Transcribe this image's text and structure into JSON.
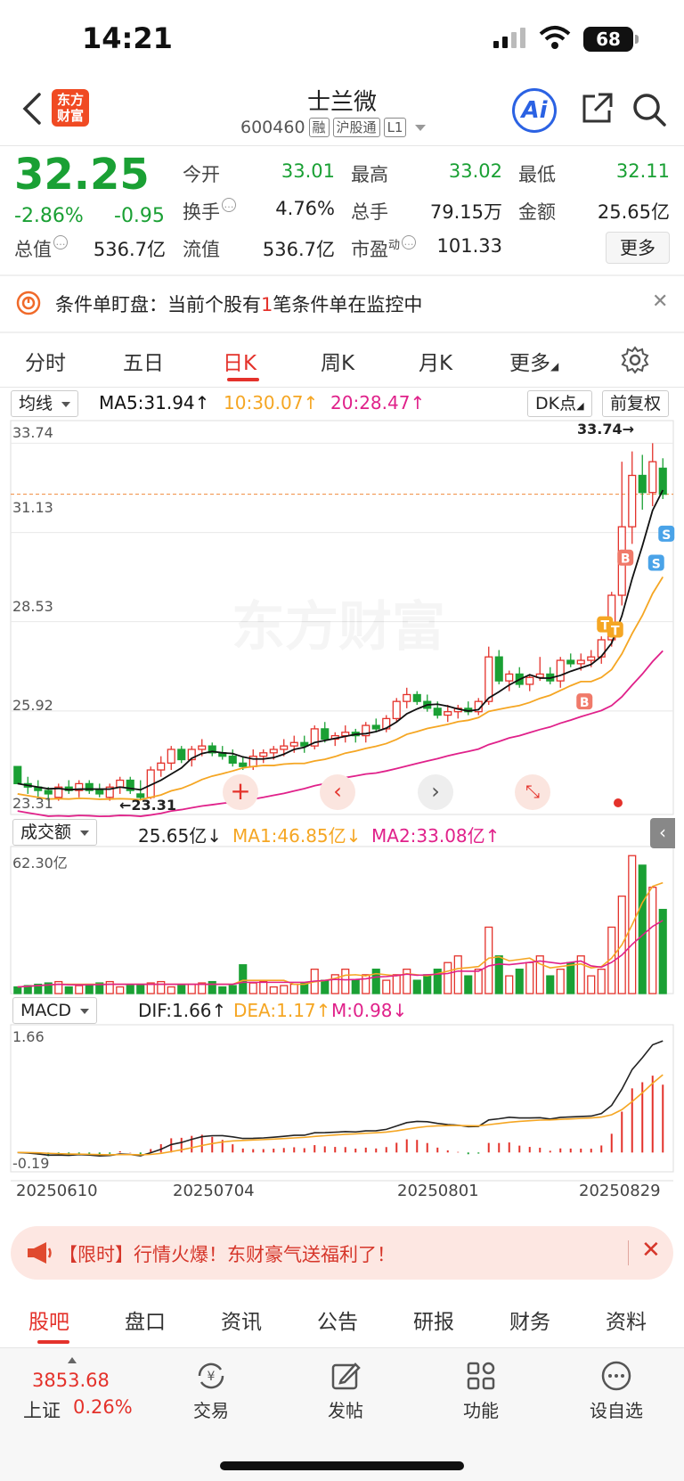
{
  "status": {
    "time": "14:21",
    "battery": "68"
  },
  "nav": {
    "logo": "东方财富",
    "title": "士兰微",
    "code": "600460",
    "tags": [
      "融",
      "沪股通",
      "L1"
    ],
    "ai_label": "Ai"
  },
  "quote": {
    "price": "32.25",
    "change_pct": "-2.86%",
    "change": "-0.95",
    "fields": [
      {
        "label": "今开",
        "value": "33.01"
      },
      {
        "label": "最高",
        "value": "33.02"
      },
      {
        "label": "最低",
        "value": "32.11"
      },
      {
        "label": "换手",
        "value": "4.76%"
      },
      {
        "label": "总手",
        "value": "79.15万"
      },
      {
        "label": "金额",
        "value": "25.65亿"
      },
      {
        "label": "总值",
        "value": "536.7亿"
      },
      {
        "label": "流值",
        "value": "536.7亿"
      },
      {
        "label": "市盈",
        "label_sup": "动",
        "value": "101.33"
      }
    ],
    "more_label": "更多"
  },
  "alert": {
    "prefix": "条件单盯盘：当前个股有",
    "count": "1",
    "suffix": "笔条件单在监控中"
  },
  "ktabs": [
    "分时",
    "五日",
    "日K",
    "周K",
    "月K",
    "更多"
  ],
  "ma_bar": {
    "select": "均线",
    "ma5": "MA5:31.94↑",
    "ma10": "10:30.07↑",
    "ma20": "20:28.47↑",
    "dk": "DK点",
    "fq": "前复权"
  },
  "colors": {
    "up": "#e4322b",
    "down": "#1aa034",
    "ma5": "#111111",
    "ma10": "#f5a623",
    "ma20": "#e0218a"
  },
  "chart_data": [
    {
      "type": "candlestick",
      "name_panel": "daily-k",
      "y_ticks": [
        "33.74",
        "31.13",
        "28.53",
        "25.92",
        "23.31"
      ],
      "ylim": [
        22.9,
        34.4
      ],
      "high_label": "33.74→",
      "low_label": "←23.31",
      "watermark": "东方财富",
      "signal_labels": [
        "B",
        "B",
        "T",
        "T",
        "S",
        "S"
      ],
      "x_dates": [
        "20250610",
        "20250704",
        "20250801",
        "20250829"
      ],
      "ohlc": [
        [
          24.3,
          24.3,
          23.8,
          23.8
        ],
        [
          23.8,
          24.0,
          23.5,
          23.7
        ],
        [
          23.7,
          23.9,
          23.4,
          23.6
        ],
        [
          23.6,
          23.7,
          23.3,
          23.5
        ],
        [
          23.4,
          23.8,
          23.3,
          23.7
        ],
        [
          23.7,
          23.9,
          23.5,
          23.6
        ],
        [
          23.6,
          23.9,
          23.4,
          23.8
        ],
        [
          23.8,
          23.9,
          23.5,
          23.6
        ],
        [
          23.6,
          23.8,
          23.4,
          23.5
        ],
        [
          23.4,
          23.8,
          23.3,
          23.7
        ],
        [
          23.7,
          24.0,
          23.5,
          23.9
        ],
        [
          23.9,
          24.0,
          23.5,
          23.6
        ],
        [
          23.5,
          23.9,
          23.31,
          23.4
        ],
        [
          23.4,
          24.3,
          23.35,
          24.2
        ],
        [
          24.2,
          24.6,
          24.0,
          24.4
        ],
        [
          24.4,
          24.9,
          24.2,
          24.8
        ],
        [
          24.8,
          24.9,
          24.4,
          24.5
        ],
        [
          24.5,
          24.9,
          24.3,
          24.8
        ],
        [
          24.8,
          25.1,
          24.6,
          24.9
        ],
        [
          24.9,
          25.0,
          24.6,
          24.7
        ],
        [
          24.7,
          24.9,
          24.5,
          24.6
        ],
        [
          24.6,
          24.8,
          24.3,
          24.4
        ],
        [
          24.4,
          24.6,
          24.2,
          24.3
        ],
        [
          24.3,
          24.8,
          24.2,
          24.6
        ],
        [
          24.6,
          24.8,
          24.4,
          24.7
        ],
        [
          24.7,
          24.9,
          24.5,
          24.8
        ],
        [
          24.8,
          25.1,
          24.6,
          24.9
        ],
        [
          24.9,
          25.2,
          24.7,
          25.0
        ],
        [
          25.0,
          25.2,
          24.7,
          24.9
        ],
        [
          24.9,
          25.5,
          24.8,
          25.4
        ],
        [
          25.4,
          25.6,
          25.0,
          25.1
        ],
        [
          25.1,
          25.3,
          24.9,
          25.2
        ],
        [
          25.2,
          25.5,
          25.0,
          25.3
        ],
        [
          25.3,
          25.4,
          25.0,
          25.2
        ],
        [
          25.2,
          25.6,
          25.0,
          25.5
        ],
        [
          25.5,
          25.7,
          25.3,
          25.4
        ],
        [
          25.4,
          25.8,
          25.3,
          25.7
        ],
        [
          25.7,
          26.3,
          25.6,
          26.2
        ],
        [
          26.2,
          26.6,
          26.0,
          26.4
        ],
        [
          26.4,
          26.5,
          26.1,
          26.2
        ],
        [
          26.2,
          26.4,
          25.9,
          26.0
        ],
        [
          26.0,
          26.2,
          25.7,
          25.8
        ],
        [
          25.8,
          26.1,
          25.6,
          25.9
        ],
        [
          25.9,
          26.1,
          25.7,
          26.0
        ],
        [
          26.0,
          26.2,
          25.8,
          25.9
        ],
        [
          25.9,
          26.3,
          25.8,
          26.2
        ],
        [
          26.2,
          27.8,
          26.1,
          27.5
        ],
        [
          27.5,
          27.7,
          26.7,
          26.8
        ],
        [
          26.8,
          27.1,
          26.5,
          27.0
        ],
        [
          27.0,
          27.2,
          26.6,
          26.7
        ],
        [
          26.7,
          27.0,
          26.5,
          26.9
        ],
        [
          26.9,
          27.5,
          26.8,
          27.0
        ],
        [
          27.0,
          27.2,
          26.7,
          26.8
        ],
        [
          26.8,
          27.5,
          26.6,
          27.4
        ],
        [
          27.4,
          27.6,
          27.2,
          27.3
        ],
        [
          27.3,
          27.6,
          27.1,
          27.4
        ],
        [
          27.4,
          27.7,
          27.2,
          27.5
        ],
        [
          27.5,
          28.1,
          27.3,
          28.0
        ],
        [
          28.0,
          29.4,
          27.8,
          29.3
        ],
        [
          29.3,
          33.2,
          29.0,
          31.3
        ],
        [
          31.3,
          33.5,
          30.8,
          32.8
        ],
        [
          32.8,
          33.4,
          31.8,
          32.3
        ],
        [
          32.3,
          33.74,
          31.9,
          33.2
        ],
        [
          33.01,
          33.3,
          32.11,
          32.25
        ]
      ],
      "series": [
        {
          "name": "MA5"
        },
        {
          "name": "10"
        },
        {
          "name": "20"
        }
      ]
    },
    {
      "type": "bar",
      "name_panel": "volume",
      "select": "成交额",
      "value_label": "25.65亿↓",
      "ma1_label": "MA1:46.85亿↓",
      "ma2_label": "MA2:33.08亿↑",
      "y_tick": "62.30亿",
      "ylim": [
        0,
        64
      ]
    },
    {
      "type": "line",
      "name_panel": "macd",
      "select": "MACD",
      "dif_label": "DIF:1.66↑",
      "dea_label": "DEA:1.17↑",
      "m_label": "M:0.98↓",
      "y_ticks": [
        "1.66",
        "-0.19"
      ]
    }
  ],
  "banner": {
    "text": "【限时】行情火爆！东财豪气送福利了！"
  },
  "btabs": [
    "股吧",
    "盘口",
    "资讯",
    "公告",
    "研报",
    "财务",
    "资料"
  ],
  "footer": {
    "index_value": "3853.68",
    "index_name": "上证",
    "index_pct": "0.26%",
    "buttons": [
      "交易",
      "发帖",
      "功能",
      "设自选"
    ]
  }
}
